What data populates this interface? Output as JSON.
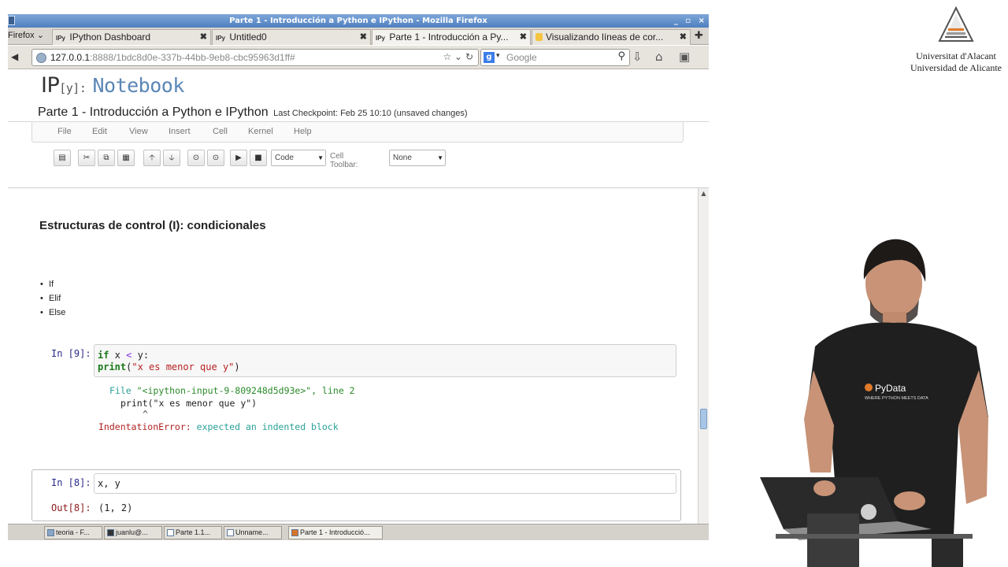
{
  "window": {
    "title": "Parte 1 - Introducción a Python e IPython - Mozilla Firefox",
    "controls": "_ ▫ ×"
  },
  "browser": {
    "menu_label": "Firefox",
    "tabs": [
      {
        "favicon": "IPy",
        "label": "IPython Dashboard",
        "active": false
      },
      {
        "favicon": "IPy",
        "label": "Untitled0",
        "active": false
      },
      {
        "favicon": "IPy",
        "label": "Parte 1 - Introducción a Py...",
        "active": true
      },
      {
        "favicon": "",
        "label": "Visualizando líneas de cor...",
        "active": false
      }
    ],
    "url_host": "127.0.0.1",
    "url_rest": ":8888/1bdc8d0e-337b-44bb-9eb8-cbc95963d1ff#",
    "search_placeholder": "Google"
  },
  "notebook": {
    "logo_ip": "IP",
    "logo_bracket": "[y]:",
    "logo_text": "Notebook",
    "name": "Parte 1 - Introducción a Python e IPython",
    "checkpoint": "Last Checkpoint: Feb 25 10:10 (unsaved changes)",
    "menu": [
      "File",
      "Edit",
      "View",
      "Insert",
      "Cell",
      "Kernel",
      "Help"
    ],
    "cell_type": "Code",
    "cell_toolbar_label": "Cell Toolbar:",
    "cell_toolbar_value": "None"
  },
  "content": {
    "heading": "Estructuras de control (I): condicionales",
    "bullets": [
      "If",
      "Elif",
      "Else"
    ],
    "cell9": {
      "prompt": "In [9]:",
      "traceback_file_word": "File",
      "traceback_file": "\"<ipython-input-9-809248d5d93e>\"",
      "traceback_line": ", line 2",
      "traceback_code": "print(\"x es menor que y\")",
      "traceback_caret": "^",
      "error_name": "IndentationError:",
      "error_msg": "expected an indented block"
    },
    "cell8": {
      "prompt_in": "In [8]:",
      "input": "x, y",
      "prompt_out": "Out[8]:",
      "output": "(1, 2)"
    }
  },
  "taskbar": [
    {
      "label": "teoria - F..."
    },
    {
      "label": "juanlu@..."
    },
    {
      "label": "Parte 1.1..."
    },
    {
      "label": "Unname..."
    },
    {
      "label": "Parte 1 - Introducció..."
    }
  ],
  "university": {
    "line1": "Universitat d'Alacant",
    "line2": "Universidad de Alicante"
  },
  "shirt": {
    "brand": "PyData",
    "tagline": "WHERE PYTHON MEETS DATA"
  }
}
